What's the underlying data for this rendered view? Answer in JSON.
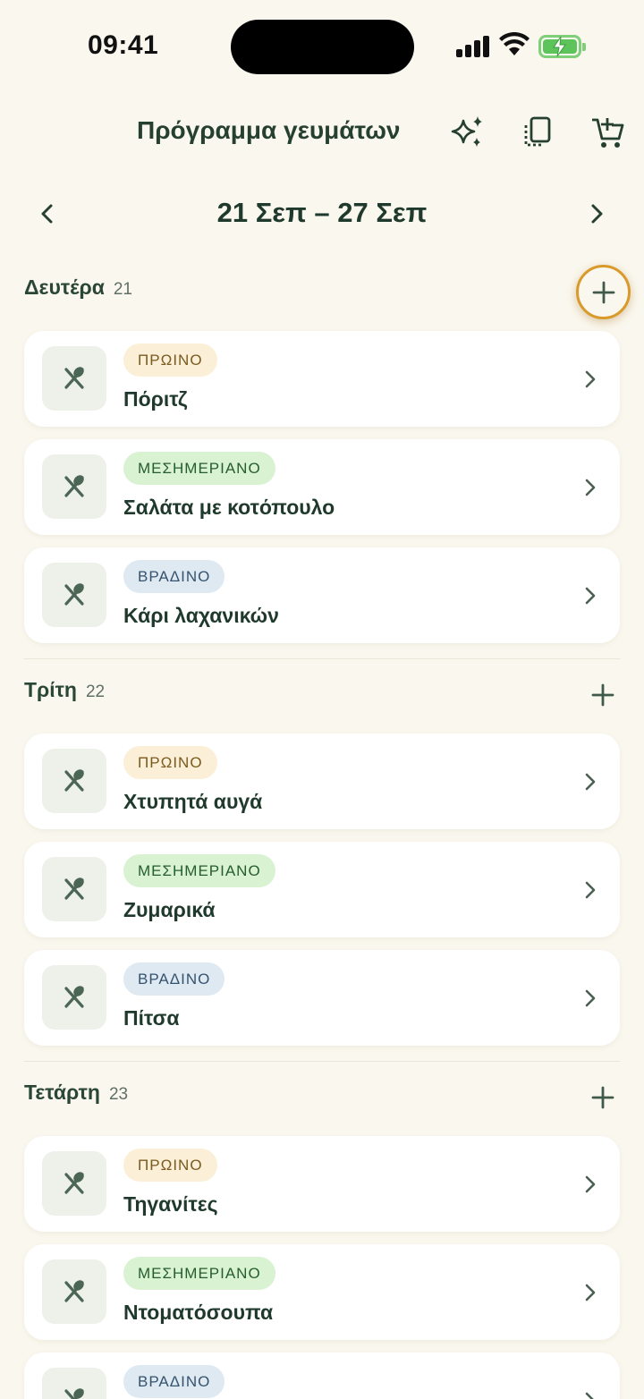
{
  "status_bar": {
    "time": "09:41"
  },
  "header": {
    "title": "Πρόγραμμα γευμάτων",
    "icons": [
      "sparkles-icon",
      "clipboard-icon",
      "cart-add-icon"
    ]
  },
  "week": {
    "range": "21 Σεπ – 27 Σεπ"
  },
  "colors": {
    "accent": "#d99a2b",
    "primary_text": "#1f3a2c",
    "background": "#faf7ee"
  },
  "days": [
    {
      "name": "Δευτέρα",
      "num": "21",
      "meals": [
        {
          "type": "ΠΡΩΙΝΟ",
          "name": "Πόριτζ"
        },
        {
          "type": "ΜΕΣΗΜΕΡΙΑΝΟ",
          "name": "Σαλάτα με κοτόπουλο"
        },
        {
          "type": "ΒΡΑΔΙΝΟ",
          "name": "Κάρι λαχανικών"
        }
      ]
    },
    {
      "name": "Τρίτη",
      "num": "22",
      "meals": [
        {
          "type": "ΠΡΩΙΝΟ",
          "name": "Χτυπητά αυγά"
        },
        {
          "type": "ΜΕΣΗΜΕΡΙΑΝΟ",
          "name": "Ζυμαρικά"
        },
        {
          "type": "ΒΡΑΔΙΝΟ",
          "name": "Πίτσα"
        }
      ]
    },
    {
      "name": "Τετάρτη",
      "num": "23",
      "meals": [
        {
          "type": "ΠΡΩΙΝΟ",
          "name": "Τηγανίτες"
        },
        {
          "type": "ΜΕΣΗΜΕΡΙΑΝΟ",
          "name": "Ντοματόσουπα"
        },
        {
          "type": "ΒΡΑΔΙΝΟ",
          "name": ""
        }
      ]
    }
  ]
}
